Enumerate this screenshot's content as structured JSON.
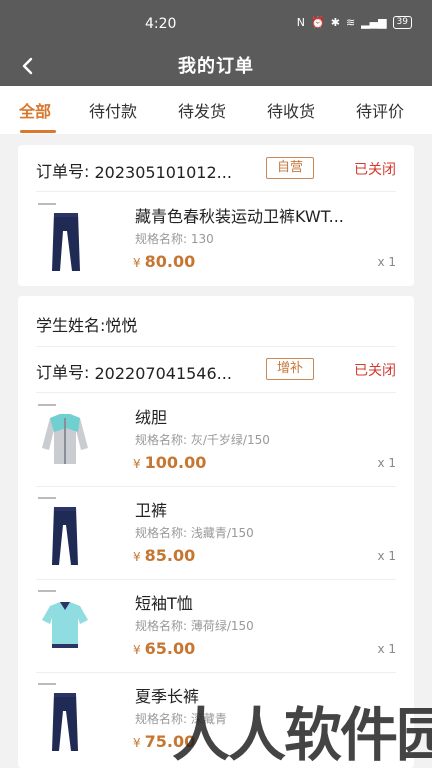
{
  "status_bar": {
    "time": "4:20",
    "battery": "39"
  },
  "nav": {
    "title": "我的订单"
  },
  "tabs": [
    "全部",
    "待付款",
    "待发货",
    "待收货",
    "待评价"
  ],
  "orders": [
    {
      "order_label": "订单号:",
      "order_no": "202305101012...",
      "tag": "自营",
      "status": "已关闭",
      "items": [
        {
          "name": "藏青色春秋装运动卫裤KWT...",
          "spec": "规格名称: 130",
          "currency": "¥",
          "price": "80.00",
          "qty": "x 1"
        }
      ]
    },
    {
      "student": "学生姓名:悦悦",
      "order_label": "订单号:",
      "order_no": "202207041546...",
      "tag": "增补",
      "status": "已关闭",
      "items": [
        {
          "name": "绒胆",
          "spec": "规格名称: 灰/千岁绿/150",
          "currency": "¥",
          "price": "100.00",
          "qty": "x 1"
        },
        {
          "name": "卫裤",
          "spec": "规格名称: 浅藏青/150",
          "currency": "¥",
          "price": "85.00",
          "qty": "x 1"
        },
        {
          "name": "短袖T恤",
          "spec": "规格名称: 薄荷绿/150",
          "currency": "¥",
          "price": "65.00",
          "qty": "x 1"
        },
        {
          "name": "夏季长裤",
          "spec": "规格名称: 深藏青",
          "currency": "¥",
          "price": "75.00",
          "qty": ""
        }
      ]
    }
  ],
  "watermark": "人人软件园",
  "colors": {
    "accent": "#d9772e",
    "status_closed": "#d43a2f",
    "header_bg": "#5b5b5b"
  }
}
